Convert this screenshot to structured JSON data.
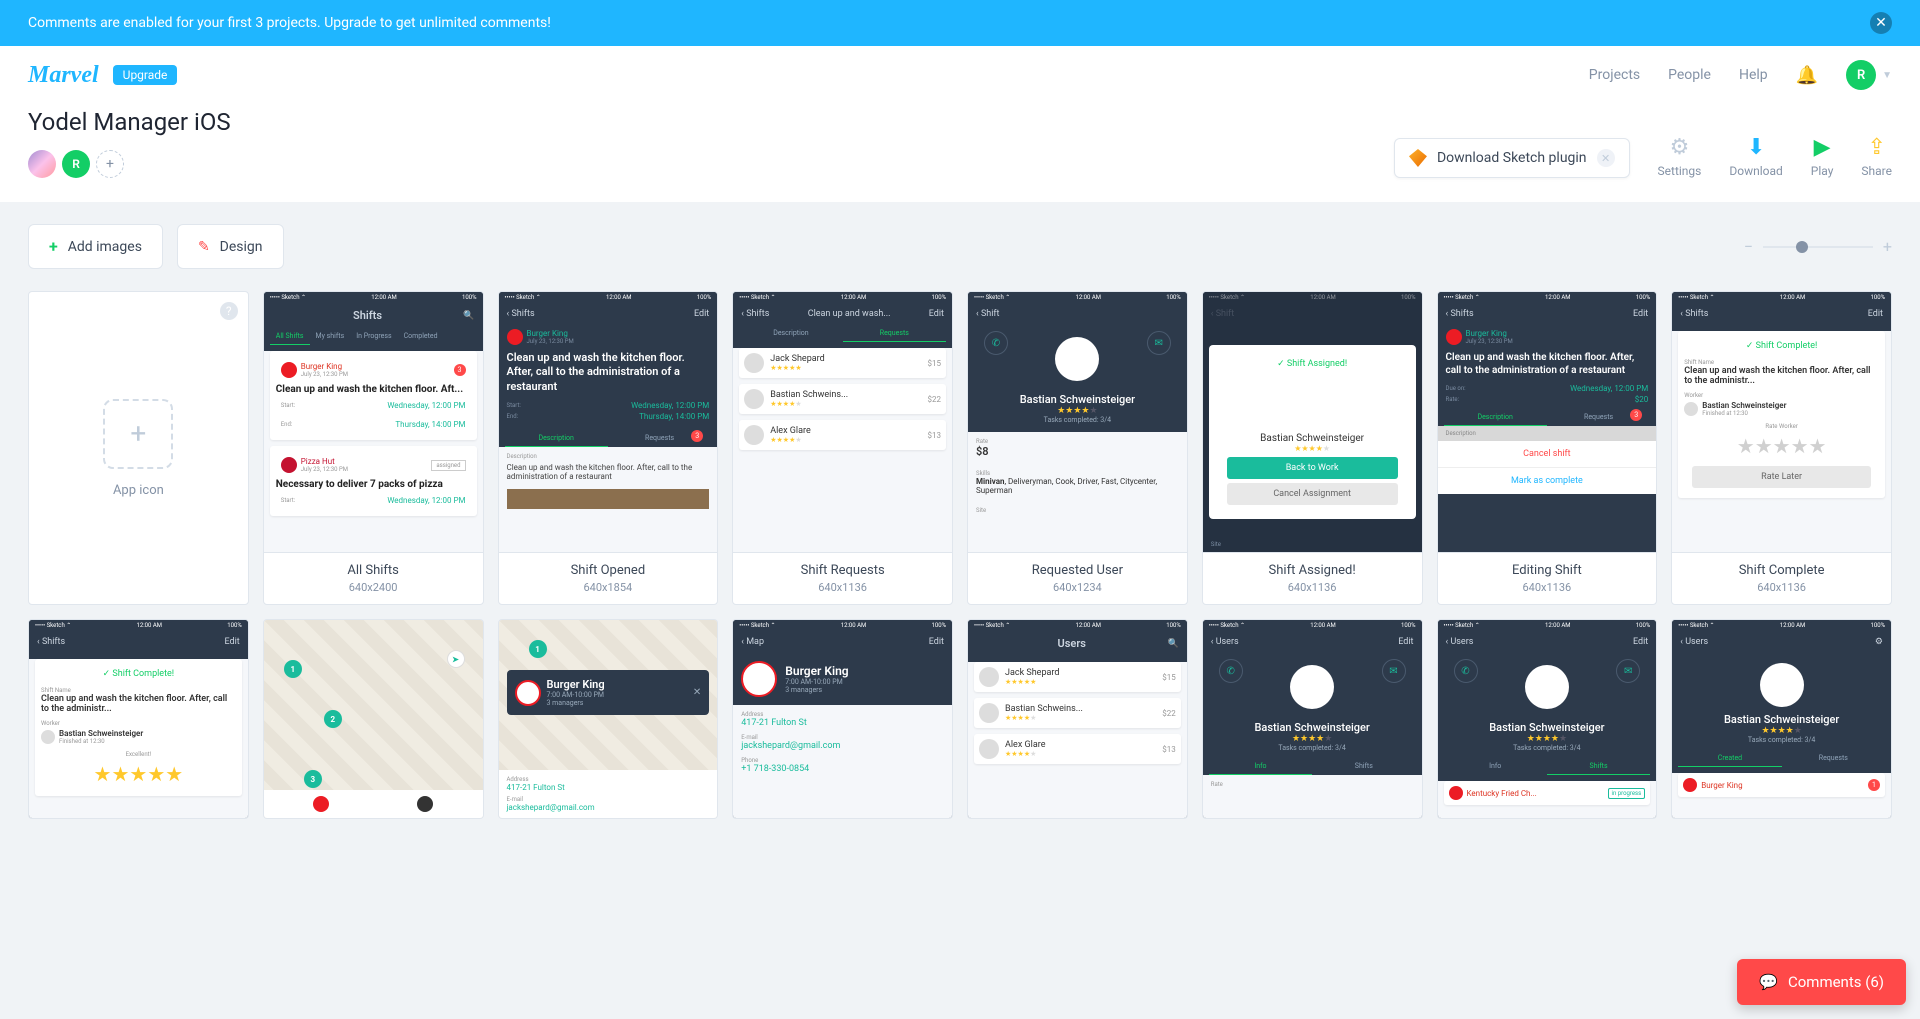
{
  "banner": {
    "text": "Comments are enabled for your first 3 projects. Upgrade to get unlimited comments!"
  },
  "topbar": {
    "logo": "Marvel",
    "upgrade": "Upgrade",
    "nav": {
      "projects": "Projects",
      "people": "People",
      "help": "Help"
    },
    "avatar_letter": "R"
  },
  "project": {
    "title": "Yodel Manager iOS",
    "collab_letter": "R",
    "sketch": "Download Sketch plugin",
    "actions": {
      "settings": "Settings",
      "download": "Download",
      "play": "Play",
      "share": "Share"
    }
  },
  "toolbar": {
    "add_images": "Add images",
    "design": "Design"
  },
  "app_icon_label": "App icon",
  "screens": [
    {
      "name": "All Shifts",
      "dim": "640x2400"
    },
    {
      "name": "Shift Opened",
      "dim": "640x1854"
    },
    {
      "name": "Shift Requests",
      "dim": "640x1136"
    },
    {
      "name": "Requested User",
      "dim": "640x1234"
    },
    {
      "name": "Shift Assigned!",
      "dim": "640x1136"
    },
    {
      "name": "Editing Shift",
      "dim": "640x1136"
    },
    {
      "name": "Shift Complete",
      "dim": "640x1136"
    }
  ],
  "ms": {
    "status_time": "12:00 AM",
    "status_carrier": "••••• Sketch ⌃",
    "status_pct": "100%",
    "shifts": "Shifts",
    "shift": "Shift",
    "users": "Users",
    "map": "Map",
    "edit": "Edit",
    "back": "‹",
    "all_shifts": "All Shifts",
    "my_shifts": "My shifts",
    "in_progress": "In Progress",
    "completed": "Completed",
    "bk": "Burger King",
    "bk_date": "July 23, 12:30 PM",
    "task1": "Clean up and wash the kitchen floor. Aft...",
    "task1_full": "Clean up and wash the kitchen floor. After, call to the administration of a restaurant",
    "task1_short": "Clean up and wash the kitchen floor. After, call to the administr...",
    "task_desc": "Clean up and wash the kitchen floor. After, call to the administration of a restaurant",
    "start": "Start:",
    "end": "End:",
    "wed": "Wednesday, 12:00 PM",
    "thu": "Thursday, 14:00 PM",
    "pizza": "Pizza Hut",
    "assigned": "assigned",
    "task2": "Necessary to deliver 7 packs of pizza",
    "description": "Description",
    "requests": "Requests",
    "req_title": "Clean up and wash...",
    "jack": "Jack Shepard",
    "bastian": "Bastian Schweins...",
    "bastian_full": "Bastian Schweinsteiger",
    "alex": "Alex Glare",
    "p15": "$15",
    "p22": "$22",
    "p13": "$13",
    "tasks_completed": "Tasks completed: 3/4",
    "rate": "Rate",
    "rate_val": "$8",
    "rate20": "$20",
    "skills": "Skills",
    "skills_list": "Minivan, Deliveryman, Cook, Driver, Fast, Citycenter, Superman",
    "site": "Site",
    "shift_assigned": "Shift Assigned!",
    "back_work": "Back to Work",
    "cancel_assign": "Cancel Assignment",
    "due_on": "Due on:",
    "cancel_shift": "Cancel shift",
    "mark_complete": "Mark as complete",
    "shift_complete": "Shift Complete!",
    "shift_name": "Shift Name",
    "worker": "Worker",
    "finished": "Finished at 12:30",
    "rate_worker": "Rate Worker",
    "rate_later": "Rate Later",
    "excellent": "Excellent!",
    "info": "Info",
    "address": "Address",
    "addr_val": "417-21 Fulton St",
    "email": "E-mail",
    "email_val": "jackshepard@gmail.com",
    "phone": "Phone",
    "phone_val": "+1 718-330-0854",
    "hours": "7:00 AM-10:00 PM",
    "managers": "3 managers",
    "kfc": "Kentucky Fried Ch...",
    "in_progress_badge": "in progress",
    "created": "Created",
    "badge3": "3",
    "badge1": "1"
  },
  "comments": {
    "label": "Comments (6)"
  }
}
